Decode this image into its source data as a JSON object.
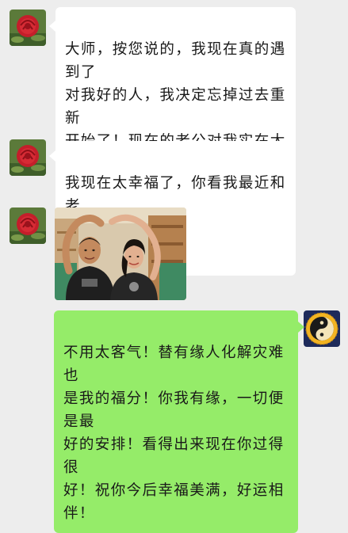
{
  "conversation": {
    "messages": [
      {
        "side": "left",
        "text": "大师，按您说的，我现在真的遇到了\n对我好的人，我决定忘掉过去重新\n开始了！现在的老公对我实在太好\n了！我感觉很幸福！我不会忘记老师\n的指点和恩德！再次表示感谢！",
        "trailing_emoji": "smile-emoji"
      },
      {
        "side": "left",
        "text": "我现在太幸福了，你看我最近和老\n公的合照"
      },
      {
        "side": "left",
        "type": "image",
        "image_description_icon": "couple-photo"
      },
      {
        "side": "right",
        "text": "不用太客气！替有缘人化解灾难也\n是我的福分！你我有缘，一切便是最\n好的安排！看得出来现在你过得很\n好！祝你今后幸福美满，好运相伴！"
      }
    ]
  },
  "colors": {
    "background": "#ededed",
    "incoming_bubble": "#ffffff",
    "outgoing_bubble": "#95ec69",
    "text": "#191919"
  }
}
